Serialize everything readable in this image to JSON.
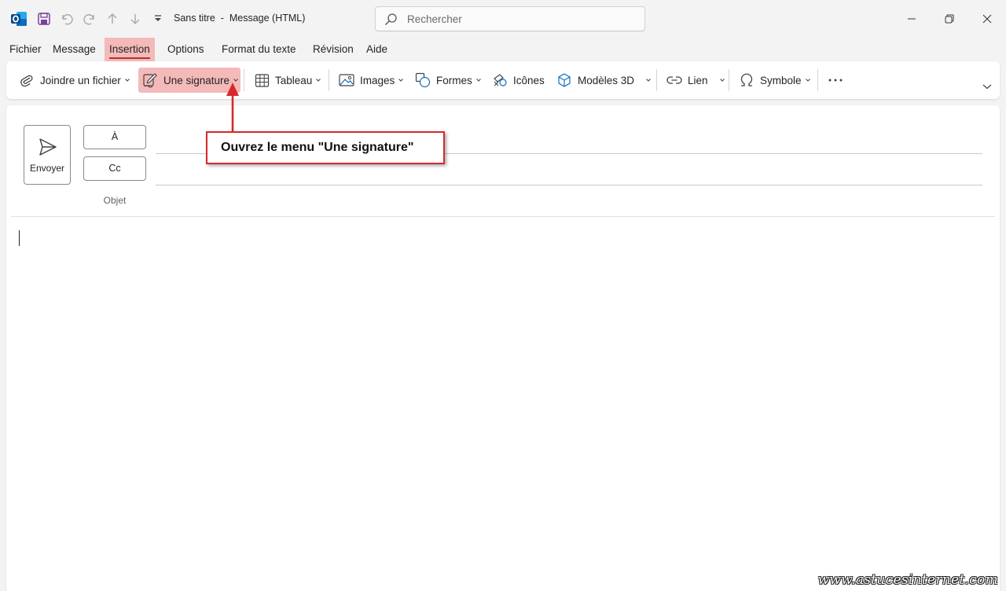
{
  "titlebar": {
    "title": "Sans titre  -  Message (HTML)",
    "search_placeholder": "Rechercher",
    "icons": [
      "outlook-logo-icon",
      "save-icon",
      "undo-icon",
      "redo-icon",
      "up-arrow-icon",
      "down-arrow-icon",
      "customize-qat-icon"
    ]
  },
  "menu": {
    "items": [
      "Fichier",
      "Message",
      "Insertion",
      "Options",
      "Format du texte",
      "Révision",
      "Aide"
    ],
    "active": "Insertion"
  },
  "ribbon": {
    "attach": "Joindre un fichier",
    "signature": "Une signature",
    "table": "Tableau",
    "images": "Images",
    "shapes": "Formes",
    "icons": "Icônes",
    "models3d": "Modèles 3D",
    "link": "Lien",
    "symbol": "Symbole"
  },
  "compose": {
    "send": "Envoyer",
    "to": "À",
    "cc": "Cc",
    "subject": "Objet"
  },
  "annotation": {
    "text": "Ouvrez le menu \"Une signature\""
  },
  "watermark": "www.astucesinternet.com",
  "colors": {
    "accent_highlight": "#f4b9b9",
    "annotation_red": "#d9282c",
    "outlook_blue": "#0f6cbd"
  }
}
